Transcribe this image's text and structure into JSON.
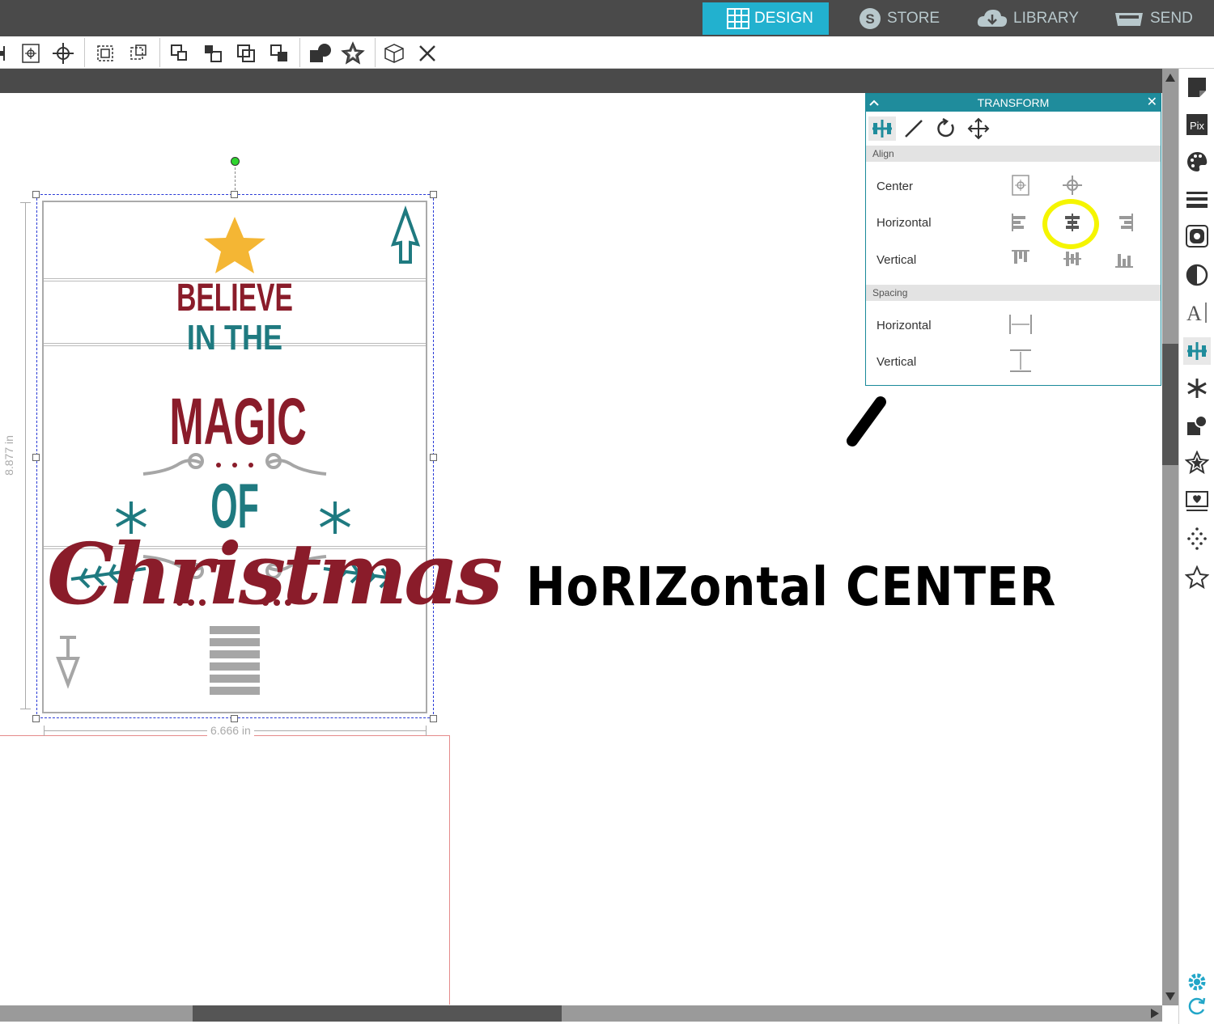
{
  "topbar": {
    "tabs": [
      {
        "label": "DESIGN",
        "active": true
      },
      {
        "label": "STORE",
        "active": false
      },
      {
        "label": "LIBRARY",
        "active": false
      },
      {
        "label": "SEND",
        "active": false
      }
    ]
  },
  "toolbar": {
    "icons": [
      "align-left-icon",
      "center-to-page-icon",
      "center-crosshair-icon",
      "group-icon",
      "ungroup-icon",
      "bring-to-front-icon",
      "bring-forward-icon",
      "send-backward-icon",
      "send-to-back-icon",
      "shape-fill-icon",
      "star-icon",
      "3d-box-icon",
      "close-icon"
    ]
  },
  "transform": {
    "title": "TRANSFORM",
    "sections": {
      "align": "Align",
      "spacing": "Spacing"
    },
    "rows": {
      "center": "Center",
      "horizontal": "Horizontal",
      "vertical": "Vertical",
      "spacing_horizontal": "Horizontal",
      "spacing_vertical": "Vertical"
    },
    "highlight_color": "#f5f500"
  },
  "design": {
    "line1": "BELIEVE",
    "line2": "IN THE",
    "line3": "MAGIC",
    "line4": "OF",
    "line5": "Christmas",
    "colors": {
      "red": "#8a1c2a",
      "teal": "#1f7a80",
      "gold": "#f4b634",
      "gray": "#a6a6a6"
    }
  },
  "dimensions": {
    "height": "8.877 in",
    "width": "6.666 in"
  },
  "annotation": {
    "text": "HoRIZontal CENTER"
  },
  "accent_color": "#22b1cf"
}
